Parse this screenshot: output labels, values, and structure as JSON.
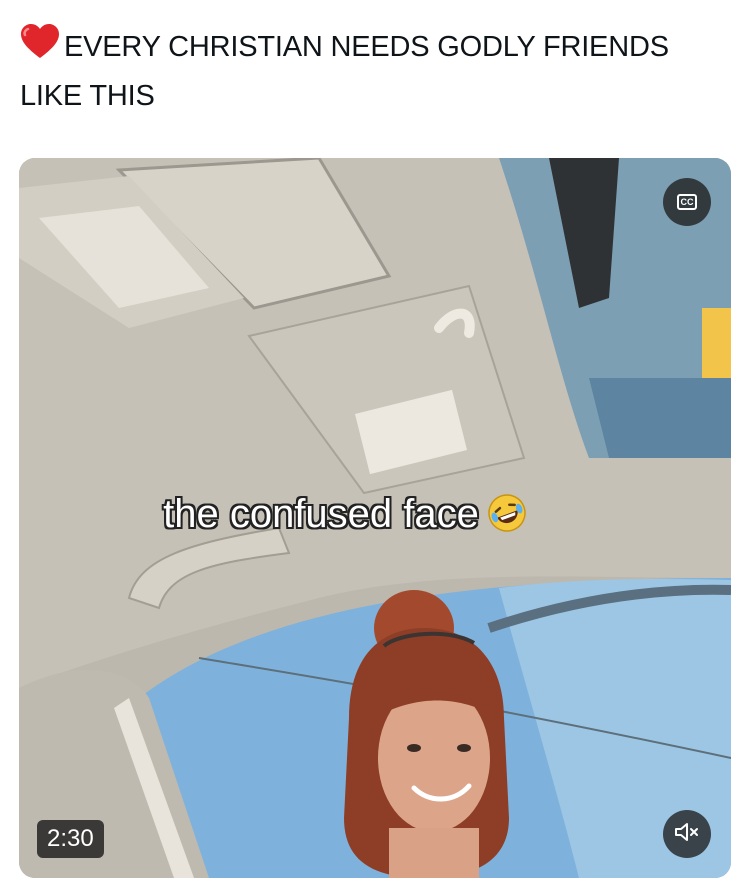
{
  "post": {
    "text": "EVERY CHRISTIAN NEEDS GODLY FRIENDS LIKE THIS",
    "leading_emoji": "heart-emoji"
  },
  "video": {
    "caption": "the confused face",
    "caption_emoji": "rolling-on-floor-laughing-emoji",
    "duration": "2:30",
    "cc_label": "CC",
    "cc_icon": "closed-captions-icon",
    "mute_icon": "speaker-muted-icon"
  }
}
